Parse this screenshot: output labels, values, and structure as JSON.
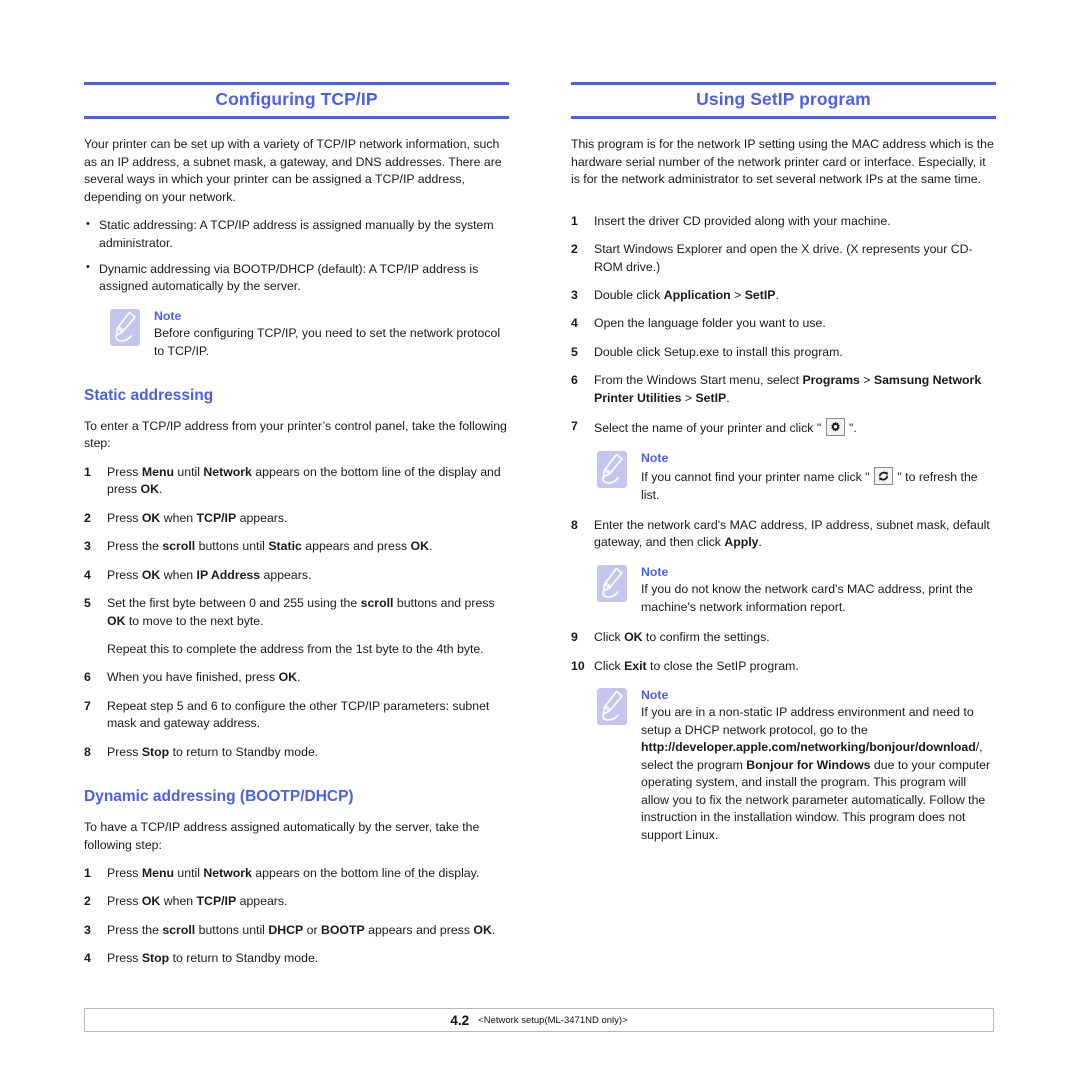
{
  "colors": {
    "accent_blue": "#4a5ef0",
    "note_icon_bg": "#c5c5ee",
    "text": "#1a1a1a"
  },
  "left_column": {
    "chapter_title": "Configuring TCP/IP",
    "intro": "Your printer can be set up with a variety of TCP/IP network information, such as an IP address, a subnet mask, a gateway, and DNS addresses. There are several ways in which your printer can be assigned a TCP/IP address, depending on your network.",
    "bullets": [
      "Static addressing: A TCP/IP address is assigned manually by the system administrator.",
      "Dynamic addressing via BOOTP/DHCP (default): A TCP/IP address is assigned automatically by the server."
    ],
    "note_1": {
      "label": "Note",
      "text": "Before configuring TCP/IP, you need to set the network protocol to TCP/IP."
    },
    "static_section": {
      "heading": "Static addressing",
      "intro": "To enter a TCP/IP address from your printer’s control panel, take the following step:",
      "steps": [
        {
          "num": "1",
          "html": "Press <b>Menu</b> until <b>Network</b> appears on the bottom line of the display and press <b>OK</b>."
        },
        {
          "num": "2",
          "html": "Press <b>OK</b> when <b>TCP/IP</b> appears."
        },
        {
          "num": "3",
          "html": "Press the <b>scroll</b> buttons until <b>Static</b> appears and press <b>OK</b>."
        },
        {
          "num": "4",
          "html": "Press <b>OK</b> when <b>IP Address</b> appears."
        },
        {
          "num": "5",
          "html": "Set the first byte between 0 and 255 using the <b>scroll</b> buttons and press <b>OK</b> to move to the next byte.",
          "cont": "Repeat this to complete the address from the 1st byte to the 4th byte."
        },
        {
          "num": "6",
          "html": "When you have finished, press <b>OK</b>."
        },
        {
          "num": "7",
          "html": "Repeat step 5 and 6 to configure the other TCP/IP parameters: subnet mask and gateway address."
        },
        {
          "num": "8",
          "html": "Press <b>Stop</b> to return to Standby mode."
        }
      ]
    },
    "dynamic_section": {
      "heading": "Dynamic addressing (BOOTP/DHCP)",
      "intro": "To have a TCP/IP address assigned automatically by the server, take the following step:",
      "steps": [
        {
          "num": "1",
          "html": "Press <b>Menu</b> until <b>Network</b> appears on the bottom line of the display."
        },
        {
          "num": "2",
          "html": "Press <b>OK</b> when <b>TCP/IP</b> appears."
        },
        {
          "num": "3",
          "html": "Press the <b>scroll</b> buttons until <b>DHCP</b> or <b>BOOTP</b> appears and press <b>OK</b>."
        },
        {
          "num": "4",
          "html": "Press <b>Stop</b> to return to Standby mode."
        }
      ]
    }
  },
  "right_column": {
    "chapter_title": "Using SetIP program",
    "intro": "This program is for the network IP setting using the MAC address which is the hardware serial number of the network printer card or interface. Especially, it is for the network administrator to set several network IPs at the same time.",
    "steps_a": [
      {
        "num": "1",
        "html": "Insert the driver CD provided along with your machine."
      },
      {
        "num": "2",
        "html": "Start Windows Explorer and open the X drive. (X represents your CD-ROM drive.)"
      },
      {
        "num": "3",
        "html": "Double click <b>Application</b> &gt; <b>SetIP</b>."
      },
      {
        "num": "4",
        "html": "Open the language folder you want to use."
      },
      {
        "num": "5",
        "html": "Double click Setup.exe to install this program."
      },
      {
        "num": "6",
        "html": "From the Windows Start menu, select <b>Programs</b> &gt; <b>Samsung Network Printer Utilities</b> &gt; <b>SetIP</b>."
      },
      {
        "num": "7",
        "html": "Select the name of your printer and click \" <!--GEAR--> \"."
      }
    ],
    "note_2": {
      "label": "Note",
      "html": "If you cannot find your printer name click \" <!--REFRESH--> \" to refresh the list."
    },
    "steps_b": [
      {
        "num": "8",
        "html": "Enter the network card's MAC address, IP address, subnet mask, default gateway, and then click <b>Apply</b>."
      }
    ],
    "note_3": {
      "label": "Note",
      "html": " If you do not know the network card's MAC address, print the machine's network information report."
    },
    "steps_c": [
      {
        "num": "9",
        "html": "Click <b>OK</b> to confirm the settings."
      },
      {
        "num": "10",
        "html": "Click <b>Exit</b> to close the SetIP program."
      }
    ],
    "note_4": {
      "label": "Note",
      "html": "If you are in a non-static IP address environment and need to setup a DHCP network protocol, go to the <b>http://developer.apple.com/networking/bonjour/download</b>/, select the program <b>Bonjour for Windows</b> due to your computer operating system, and install the program. This program will allow you to fix the network parameter automatically. Follow the instruction in the installation window. This program does not support Linux."
    }
  },
  "footer": {
    "page_number": "4.2",
    "doc_title": "<Network setup(ML-3471ND only)>"
  }
}
